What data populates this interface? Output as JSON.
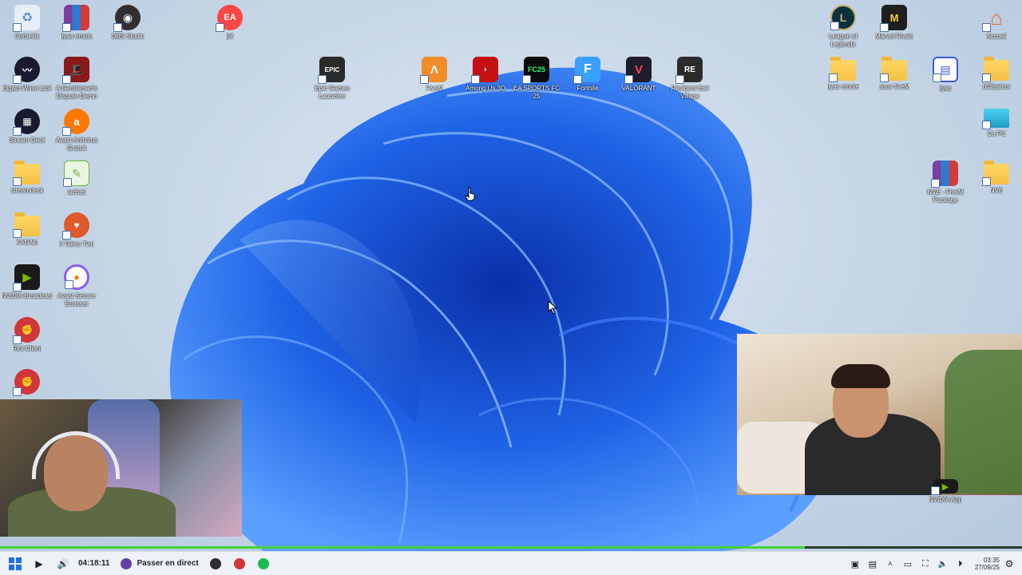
{
  "desktop": {
    "icons": [
      {
        "id": "corbeille",
        "label": "Corbeille",
        "icon": "recycle-bin-icon",
        "color": "#e8eef5"
      },
      {
        "id": "ilyas-emote-rar",
        "label": "ilyas emote",
        "icon": "winrar-icon",
        "color": "#7b3fa0"
      },
      {
        "id": "obs",
        "label": "OBS Studio",
        "icon": "obs-icon",
        "color": "#302e31"
      },
      {
        "id": "ea",
        "label": "EA",
        "icon": "ea-icon",
        "color": "#ff4747"
      },
      {
        "id": "league",
        "label": "League of Legends",
        "icon": "league-icon",
        "color": "#0a323c"
      },
      {
        "id": "marvel",
        "label": "Marvel Rivals",
        "icon": "marvel-rivals-icon",
        "color": "#1f1f1f"
      },
      {
        "id": "accueil",
        "label": "Accueil",
        "icon": "home-icon",
        "color": "#f26b21"
      },
      {
        "id": "wavelink",
        "label": "Elgato Wave Link",
        "icon": "wave-link-icon",
        "color": "#1a1a2e"
      },
      {
        "id": "gentleman",
        "label": "A Gentleman's Dispute Demo",
        "icon": "top-hat-icon",
        "color": "#8a1a1a"
      },
      {
        "id": "epic",
        "label": "Epic Games Launcher",
        "icon": "epic-icon",
        "color": "#2a2a2a"
      },
      {
        "id": "fivem",
        "label": "FiveM",
        "icon": "fivem-icon",
        "color": "#f28c28"
      },
      {
        "id": "amongus",
        "label": "Among Us 3D",
        "icon": "among-us-icon",
        "color": "#c51111"
      },
      {
        "id": "fc25",
        "label": "EA SPORTS FC 25",
        "icon": "fc25-icon",
        "color": "#0b0b0b"
      },
      {
        "id": "fortnite",
        "label": "Fortnite",
        "icon": "fortnite-icon",
        "color": "#3aa0ff"
      },
      {
        "id": "valorant",
        "label": "VALORANT",
        "icon": "valorant-icon",
        "color": "#fd4556"
      },
      {
        "id": "re-village",
        "label": "Resident Evil Village",
        "icon": "re-village-icon",
        "color": "#2b2b2b"
      },
      {
        "id": "ilyas-emote-folder",
        "label": "ilyas emote",
        "icon": "folder-icon",
        "color": "#f5c043"
      },
      {
        "id": "sauv-fivem",
        "label": "sauv fiveM",
        "icon": "folder-icon",
        "color": "#f5c043"
      },
      {
        "id": "ilyas-doc",
        "label": "ilyas",
        "icon": "document-icon",
        "color": "#3b5bdb"
      },
      {
        "id": "utilisateur",
        "label": "Utilisateur",
        "icon": "folder-icon",
        "color": "#f5c043"
      },
      {
        "id": "streamdeck",
        "label": "Stream Deck",
        "icon": "stream-deck-icon",
        "color": "#1a1a2e"
      },
      {
        "id": "avast-av",
        "label": "Avast Antivirus Gratuit",
        "icon": "avast-icon",
        "color": "#ff7800"
      },
      {
        "id": "cepc",
        "label": "Ce PC",
        "icon": "monitor-icon",
        "color": "#2bb5d8"
      },
      {
        "id": "streamdeck-folder",
        "label": "streamdeck",
        "icon": "folder-icon",
        "color": "#f5c043"
      },
      {
        "id": "taches",
        "label": "taches",
        "icon": "notepad-icon",
        "color": "#6cb33f"
      },
      {
        "id": "nve-rar",
        "label": "NVE - FiveM Package",
        "icon": "winrar-icon",
        "color": "#7b3fa0"
      },
      {
        "id": "nve",
        "label": "NVE",
        "icon": "folder-icon",
        "color": "#f5c043"
      },
      {
        "id": "kanali",
        "label": "KANALI",
        "icon": "folder-icon",
        "color": "#f5c043"
      },
      {
        "id": "ittakestwo",
        "label": "It Takes Two",
        "icon": "it-takes-two-icon",
        "color": "#e0592a"
      },
      {
        "id": "nv-broadcast",
        "label": "NVIDIA Broadcast",
        "icon": "nvidia-icon",
        "color": "#1a1a1a"
      },
      {
        "id": "avast-browser",
        "label": "Avast Secure Browser",
        "icon": "avast-browser-icon",
        "color": "#ffffff"
      },
      {
        "id": "riot",
        "label": "Riot Client",
        "icon": "riot-icon",
        "color": "#d13639"
      },
      {
        "id": "riot2",
        "label": "",
        "icon": "riot-icon",
        "color": "#d13639"
      },
      {
        "id": "nvidia-app",
        "label": "NVIDIA App",
        "icon": "nvidia-icon",
        "color": "#1a1a1a"
      }
    ]
  },
  "taskbar": {
    "timer": "04:18:11",
    "live_label": "Passer en direct",
    "clock_time": "03:35",
    "clock_date": "27/09/25"
  },
  "colors": {
    "accent_green": "#43d13a",
    "wallpaper_blue": "#1f63e6"
  }
}
